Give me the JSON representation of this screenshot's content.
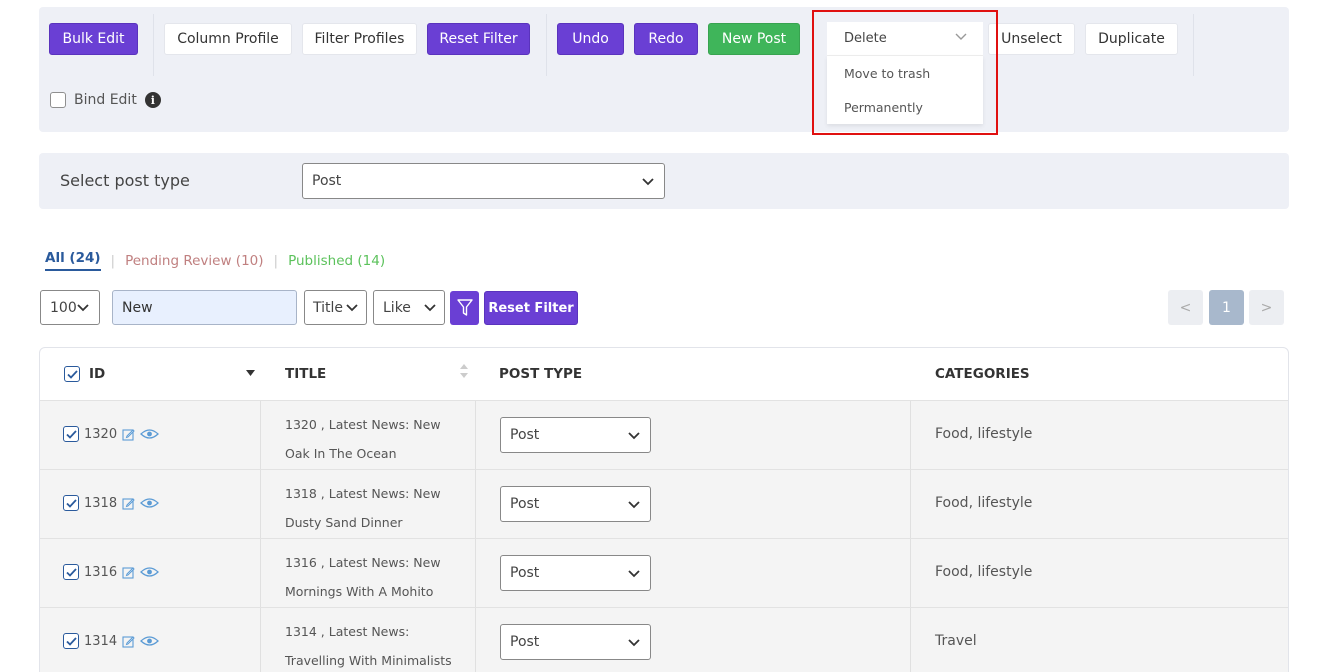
{
  "toolbar": {
    "bulk_edit": "Bulk Edit",
    "column_profile": "Column Profile",
    "filter_profiles": "Filter Profiles",
    "reset_filter": "Reset Filter",
    "undo": "Undo",
    "redo": "Redo",
    "new_post": "New Post",
    "unselect": "Unselect",
    "duplicate": "Duplicate",
    "bind_edit": "Bind Edit",
    "delete_dropdown": {
      "selected": "Delete",
      "options": [
        "Move to trash",
        "Permanently"
      ]
    }
  },
  "post_type": {
    "label": "Select post type",
    "value": "Post"
  },
  "status_tabs": {
    "all": "All (24)",
    "pending": "Pending Review (10)",
    "published": "Published (14)"
  },
  "filters": {
    "per_page": "100",
    "search_value": "New",
    "field": "Title",
    "operator": "Like",
    "reset_filter": "Reset Filter"
  },
  "pagination": {
    "prev": "<",
    "current": "1",
    "next": ">"
  },
  "table": {
    "headers": [
      "ID",
      "TITLE",
      "POST TYPE",
      "CATEGORIES"
    ],
    "rows": [
      {
        "id": "1320",
        "title_line1": "1320 , Latest News: New",
        "title_line2": "Oak In The Ocean",
        "post_type": "Post",
        "categories": "Food, lifestyle"
      },
      {
        "id": "1318",
        "title_line1": "1318 , Latest News: New",
        "title_line2": "Dusty Sand Dinner",
        "post_type": "Post",
        "categories": "Food, lifestyle"
      },
      {
        "id": "1316",
        "title_line1": "1316 , Latest News: New",
        "title_line2": "Mornings With A Mohito",
        "post_type": "Post",
        "categories": "Food, lifestyle"
      },
      {
        "id": "1314",
        "title_line1": "1314 , Latest News:",
        "title_line2": "Travelling With Minimalists",
        "post_type": "Post",
        "categories": "Travel"
      }
    ]
  },
  "colors": {
    "purple": "#6a3fd4",
    "green": "#3fb55a",
    "toolbar_bg": "#eef0f6",
    "highlight": "#e01010",
    "link_blue": "#2a5a9c"
  }
}
